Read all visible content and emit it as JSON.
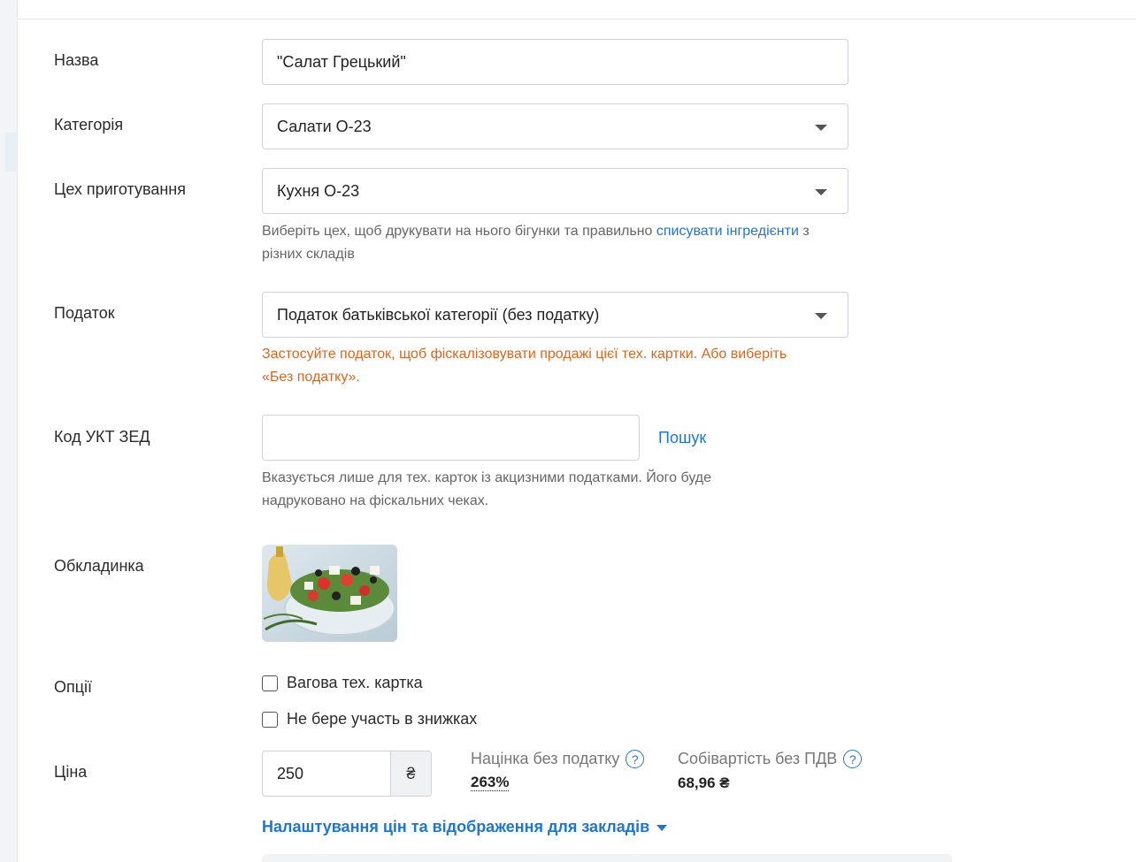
{
  "form": {
    "name": {
      "label": "Назва",
      "value": "\"Салат Грецький\""
    },
    "category": {
      "label": "Категорія",
      "value": "Салати О-23"
    },
    "workshop": {
      "label": "Цех приготування",
      "value": "Кухня О-23",
      "hint_before": "Виберіть цех, щоб друкувати на нього бігунки та правильно ",
      "hint_link": "списувати інгредієнти",
      "hint_after": " з різних складів"
    },
    "tax": {
      "label": "Податок",
      "value": "Податок батьківської категорії (без податку)",
      "warning": "Застосуйте податок, щоб фіскалізовувати продажі цієї тех. картки. Або виберіть «Без податку»."
    },
    "uktzed": {
      "label": "Код УКТ ЗЕД",
      "value": "",
      "search_link": "Пошук",
      "hint": "Вказується лише для тех. карток із акцизними податками. Його буде надруковано на фіскальних чеках."
    },
    "cover": {
      "label": "Обкладинка"
    },
    "options": {
      "label": "Опції",
      "weighted": "Вагова тех. картка",
      "no_discounts": "Не бере участь в знижках"
    },
    "price": {
      "label": "Ціна",
      "value": "250",
      "currency": "₴",
      "markup_label": "Націнка без податку",
      "markup_value": "263%",
      "cost_label": "Собівартість без ПДВ",
      "cost_value": "68,96 ₴"
    },
    "settings_link": "Налаштування цін та відображення для закладів"
  },
  "icons": {
    "help": "question-circle-icon",
    "caret": "caret-down-icon"
  },
  "colors": {
    "link": "#1f77cc",
    "warning": "#d9661f"
  }
}
